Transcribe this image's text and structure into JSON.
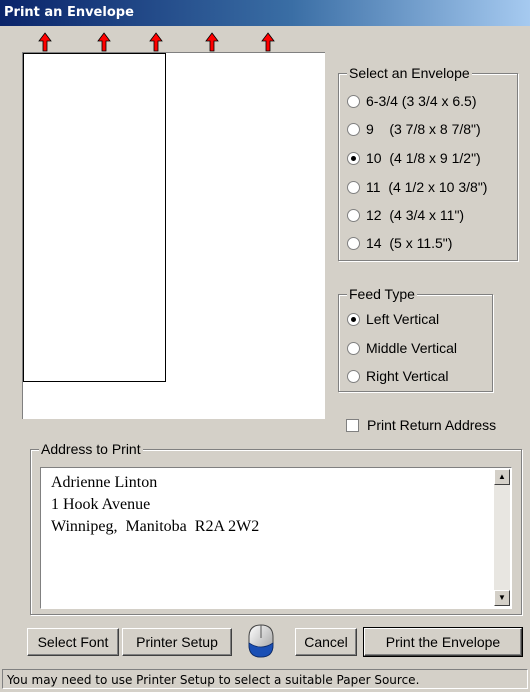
{
  "window": {
    "title": "Print an Envelope"
  },
  "envelope_group": {
    "title": "Select an Envelope",
    "options": [
      {
        "label": "6-3/4 (3 3/4 x 6.5)",
        "selected": false
      },
      {
        "label": "9    (3 7/8 x 8 7/8\")",
        "selected": false
      },
      {
        "label": "10  (4 1/8 x 9 1/2\")",
        "selected": true
      },
      {
        "label": "11  (4 1/2 x 10 3/8\")",
        "selected": false
      },
      {
        "label": "12  (4 3/4 x 11\")",
        "selected": false
      },
      {
        "label": "14  (5 x 11.5\")",
        "selected": false
      }
    ]
  },
  "feed_group": {
    "title": "Feed Type",
    "options": [
      {
        "label": "Left Vertical",
        "selected": true
      },
      {
        "label": "Middle Vertical",
        "selected": false
      },
      {
        "label": "Right Vertical",
        "selected": false
      }
    ]
  },
  "return_address": {
    "label": "Print Return Address",
    "checked": false
  },
  "address_group": {
    "title": "Address to Print",
    "text": "Adrienne Linton\n1 Hook Avenue\nWinnipeg,  Manitoba  R2A 2W2"
  },
  "buttons": {
    "select_font": "Select Font",
    "printer_setup": "Printer Setup",
    "cancel": "Cancel",
    "print": "Print the Envelope"
  },
  "status": "You may need to use Printer Setup to select a suitable Paper Source.",
  "colors": {
    "title_start": "#0a246a",
    "title_end": "#a6caf0",
    "arrow": "#ff0000",
    "face": "#d4d0c8"
  },
  "icons": {
    "arrow": "red-up-arrow-icon",
    "mouse": "mouse-icon"
  }
}
